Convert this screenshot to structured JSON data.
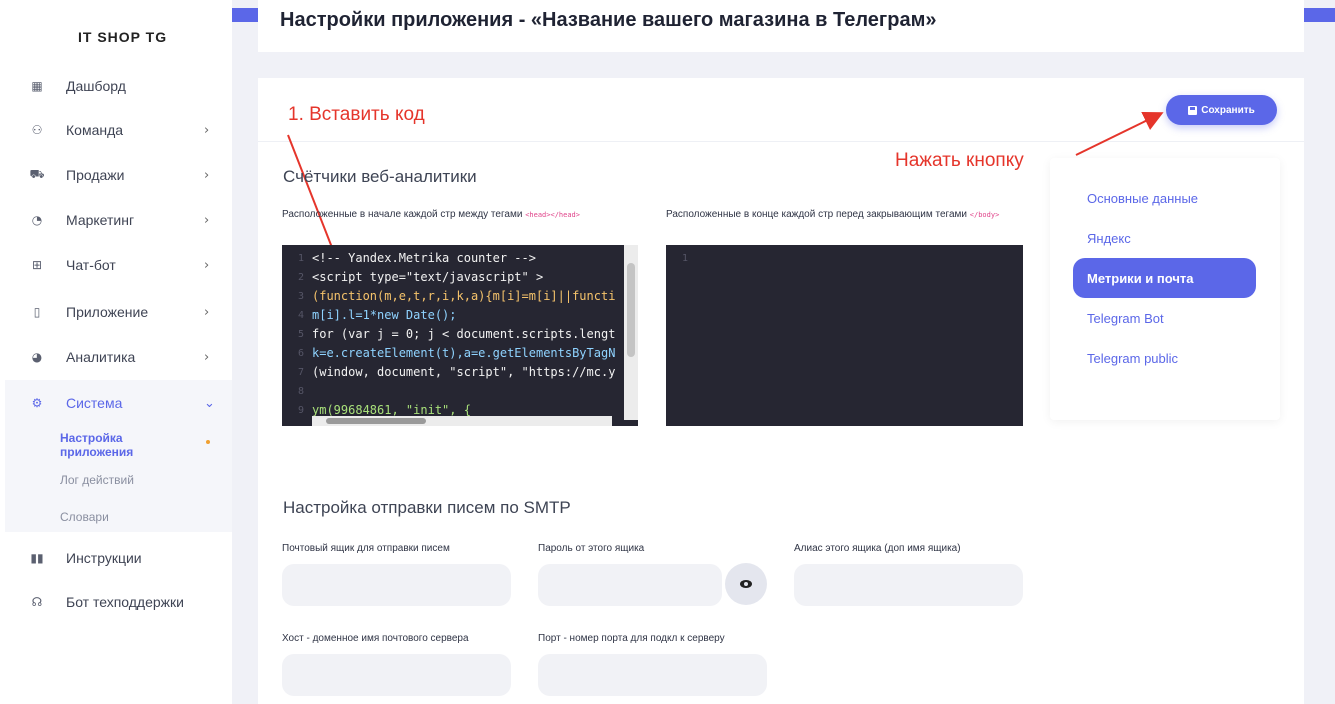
{
  "sidebar": {
    "brand": "IT SHOP TG",
    "items": [
      {
        "label": "Дашборд",
        "icon": "grid-icon",
        "chevron": ""
      },
      {
        "label": "Команда",
        "icon": "users-icon",
        "chevron": "›"
      },
      {
        "label": "Продажи",
        "icon": "cart-icon",
        "chevron": "›"
      },
      {
        "label": "Маркетинг",
        "icon": "megaphone-icon",
        "chevron": "›"
      },
      {
        "label": "Чат-бот",
        "icon": "robot-icon",
        "chevron": "›"
      },
      {
        "label": "Приложение",
        "icon": "phone-icon",
        "chevron": "›"
      },
      {
        "label": "Аналитика",
        "icon": "pie-chart-icon",
        "chevron": "›"
      },
      {
        "label": "Система",
        "icon": "gears-icon",
        "chevron": "⌄"
      },
      {
        "label": "Инструкции",
        "icon": "book-icon",
        "chevron": ""
      },
      {
        "label": "Бот техподдержки",
        "icon": "headset-icon",
        "chevron": ""
      }
    ],
    "submenu": [
      "Настройка приложения",
      "Лог действий",
      "Словари"
    ]
  },
  "header": {
    "title": "Настройки приложения - «Название вашего магазина в Телеграм»"
  },
  "toolbar": {
    "save_label": "Сохранить"
  },
  "annotations": {
    "insert_code": "1. Вставить код",
    "press_button": "Нажать кнопку"
  },
  "analytics": {
    "title": "Счётчики веб-аналитики",
    "head_label": "Расположенные в начале каждой стр между тегами",
    "head_tag": "<head></head>",
    "body_label": "Расположенные в конце каждой стр перед закрывающим тегами",
    "body_tag": "</body>",
    "head_code": [
      "<!-- Yandex.Metrika counter -->",
      "<script type=\"text/javascript\" >",
      "   (function(m,e,t,r,i,k,a){m[i]=m[i]||functi",
      "   m[i].l=1*new Date();",
      "   for (var j = 0; j < document.scripts.lengt",
      "   k=e.createElement(t),a=e.getElementsByTagN",
      "   (window, document, \"script\", \"https://mc.y",
      "",
      "   ym(99684861, \"init\", {"
    ],
    "body_code": [
      ""
    ]
  },
  "tabs": [
    "Основные данные",
    "Яндекс",
    "Метрики и почта",
    "Telegram Bot",
    "Telegram public"
  ],
  "smtp": {
    "title": "Настройка отправки писем по SMTP",
    "mailbox_label": "Почтовый ящик для отправки писем",
    "password_label": "Пароль от этого ящика",
    "alias_label": "Алиас этого ящика (доп имя ящика)",
    "host_label": "Хост - доменное имя почтового сервера",
    "port_label": "Порт - номер порта для подкл к серверу"
  },
  "colors": {
    "accent": "#5b67e8",
    "annotation": "#e5352b",
    "editor_bg": "#262632"
  }
}
